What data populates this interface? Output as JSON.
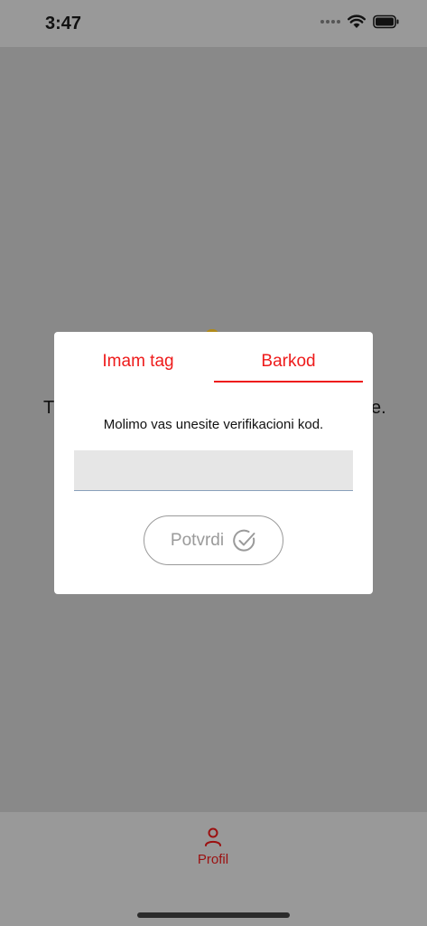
{
  "status_bar": {
    "time": "3:47"
  },
  "background": {
    "text_left": "T",
    "text_right": "e."
  },
  "dialog": {
    "tabs": [
      {
        "label": "Imam tag",
        "active": false
      },
      {
        "label": "Barkod",
        "active": true
      }
    ],
    "prompt": "Molimo vas unesite verifikacioni kod.",
    "code_input": {
      "value": "",
      "placeholder": ""
    },
    "confirm_label": "Potvrdi"
  },
  "tab_bar": {
    "profile_label": "Profil"
  },
  "colors": {
    "accent_red": "#ee1b1b",
    "tab_bar_label": "#9b1010",
    "overlay": "#898989",
    "button_gray": "#9a9a9a"
  }
}
